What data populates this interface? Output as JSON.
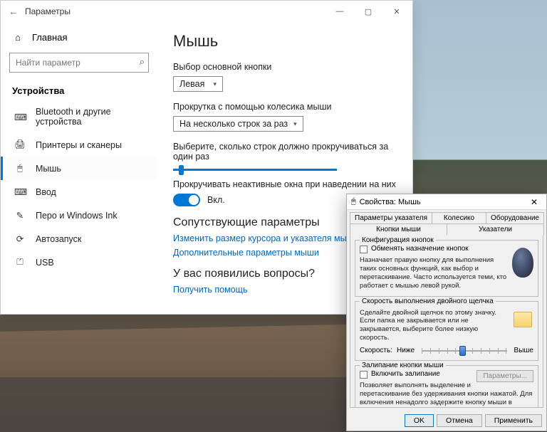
{
  "settings": {
    "title": "Параметры",
    "home": "Главная",
    "search_placeholder": "Найти параметр",
    "group": "Устройства",
    "nav": [
      {
        "icon": "⌨",
        "label": "Bluetooth и другие устройства"
      },
      {
        "icon": "🖨",
        "label": "Принтеры и сканеры"
      },
      {
        "icon": "🖱",
        "label": "Мышь"
      },
      {
        "icon": "⌨",
        "label": "Ввод"
      },
      {
        "icon": "✎",
        "label": "Перо и Windows Ink"
      },
      {
        "icon": "⟳",
        "label": "Автозапуск"
      },
      {
        "icon": "⏍",
        "label": "USB"
      }
    ],
    "content": {
      "heading": "Мышь",
      "primary_label": "Выбор основной кнопки",
      "primary_value": "Левая",
      "scroll_label": "Прокрутка с помощью колесика мыши",
      "scroll_value": "На несколько строк за раз",
      "lines_label": "Выберите, сколько строк должно прокручиваться за один раз",
      "inactive_label": "Прокручивать неактивные окна при наведении на них",
      "toggle_state": "Вкл.",
      "related_heading": "Сопутствующие параметры",
      "link_cursor": "Изменить размер курсора и указателя мыши",
      "link_additional": "Дополнительные параметры мыши",
      "questions_heading": "У вас появились вопросы?",
      "link_help": "Получить помощь"
    }
  },
  "props": {
    "title": "Свойства: Мышь",
    "tabs_row1": [
      "Параметры указателя",
      "Колесико",
      "Оборудование"
    ],
    "tabs_row2": [
      "Кнопки мыши",
      "Указатели"
    ],
    "group_config": {
      "legend": "Конфигурация кнопок",
      "checkbox": "Обменять назначение кнопок",
      "desc": "Назначает правую кнопку для выполнения таких основных функций, как выбор и перетаскивание. Часто используется теми, кто работает с мышью левой рукой."
    },
    "group_speed": {
      "legend": "Скорость выполнения двойного щелчка",
      "desc": "Сделайте двойной щелчок по этому значку. Если папка не закрывается или не закрывается, выберите более низкую скорость.",
      "label_speed": "Скорость:",
      "label_low": "Ниже",
      "label_high": "Выше"
    },
    "group_lock": {
      "legend": "Залипание кнопки мыши",
      "checkbox": "Включить залипание",
      "params_btn": "Параметры...",
      "desc": "Позволяет выполнять выделение и перетаскивание без удерживания кнопки нажатой. Для включения ненадолго задержите кнопку мыши в нажатом положении. Для освобождения снова сделайте щелчок."
    },
    "buttons": {
      "ok": "OK",
      "cancel": "Отмена",
      "apply": "Применить"
    }
  }
}
